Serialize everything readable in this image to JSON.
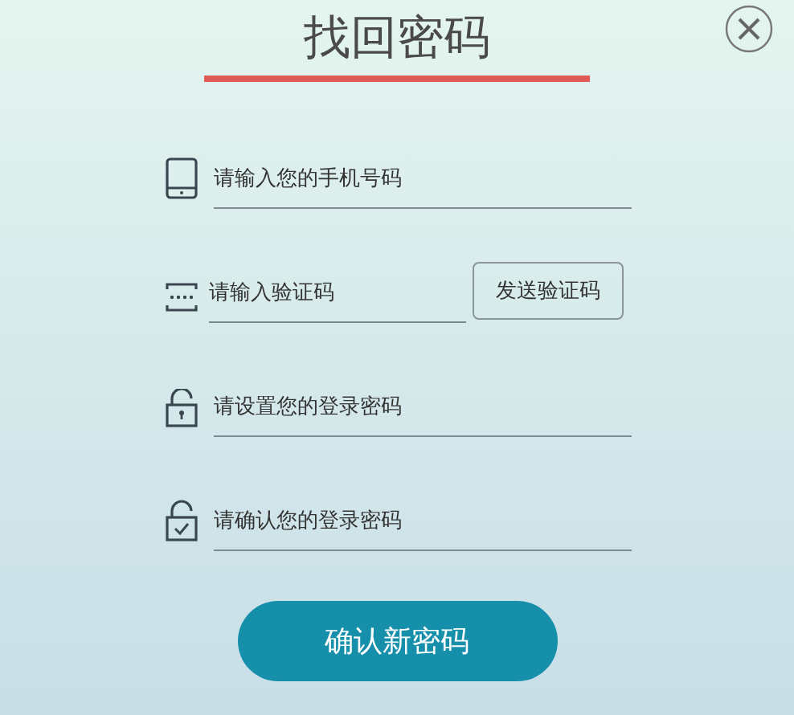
{
  "title": "找回密码",
  "fields": [
    {
      "kind": "phone",
      "placeholder": "请输入您的手机号码"
    },
    {
      "kind": "code",
      "placeholder": "请输入验证码",
      "button": "发送验证码"
    },
    {
      "kind": "lock",
      "placeholder": "请设置您的登录密码"
    },
    {
      "kind": "lock-check",
      "placeholder": "请确认您的登录密码"
    }
  ],
  "submit": "确认新密码"
}
